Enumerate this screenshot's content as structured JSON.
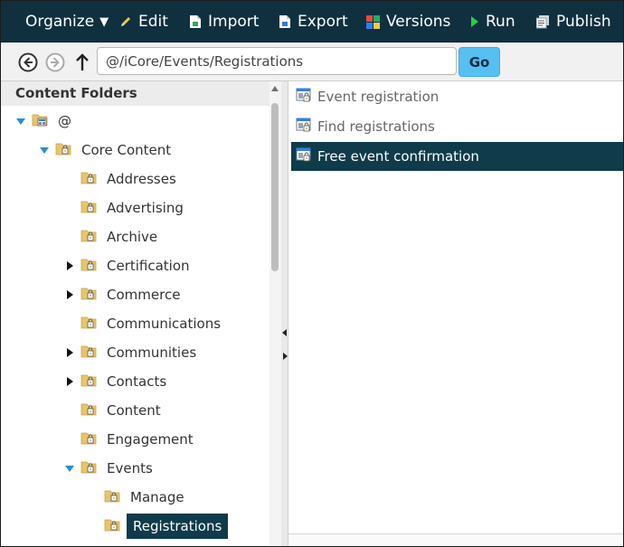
{
  "toolbar": {
    "organize": "Organize",
    "edit": "Edit",
    "import": "Import",
    "export": "Export",
    "versions": "Versions",
    "run": "Run",
    "publish": "Publish"
  },
  "address": {
    "path": "@/iCore/Events/Registrations",
    "go_label": "Go"
  },
  "left_panel": {
    "title": "Content Folders",
    "tree": [
      {
        "label": "@",
        "state": "expanded"
      },
      {
        "label": "Core Content",
        "state": "expanded"
      },
      {
        "label": "Addresses",
        "state": "leaf"
      },
      {
        "label": "Advertising",
        "state": "leaf"
      },
      {
        "label": "Archive",
        "state": "leaf"
      },
      {
        "label": "Certification",
        "state": "collapsed"
      },
      {
        "label": "Commerce",
        "state": "collapsed"
      },
      {
        "label": "Communications",
        "state": "leaf"
      },
      {
        "label": "Communities",
        "state": "collapsed"
      },
      {
        "label": "Contacts",
        "state": "collapsed"
      },
      {
        "label": "Content",
        "state": "leaf"
      },
      {
        "label": "Engagement",
        "state": "leaf"
      },
      {
        "label": "Events",
        "state": "expanded"
      },
      {
        "label": "Manage",
        "state": "leaf"
      },
      {
        "label": "Registrations",
        "state": "leaf",
        "selected": true
      }
    ]
  },
  "right_panel": {
    "items": [
      {
        "label": "Event registration"
      },
      {
        "label": "Find registrations"
      },
      {
        "label": "Free event confirmation",
        "selected": true
      }
    ]
  },
  "icons": {
    "edit": "pencil-icon",
    "import": "import-icon",
    "export": "export-icon",
    "versions": "versions-icon",
    "run": "run-icon",
    "publish": "publish-icon",
    "back": "back-icon",
    "forward": "forward-icon",
    "up": "up-arrow-icon",
    "folder": "locked-folder-icon",
    "root": "root-folder-icon",
    "item": "content-item-icon"
  },
  "colors": {
    "toolbar_bg": "#10303f",
    "selected_bg": "#0f3b4b",
    "go_button": "#56c0f2",
    "tree_expand_arrow": "#2a8ed6",
    "folder": "#e8c56a"
  }
}
